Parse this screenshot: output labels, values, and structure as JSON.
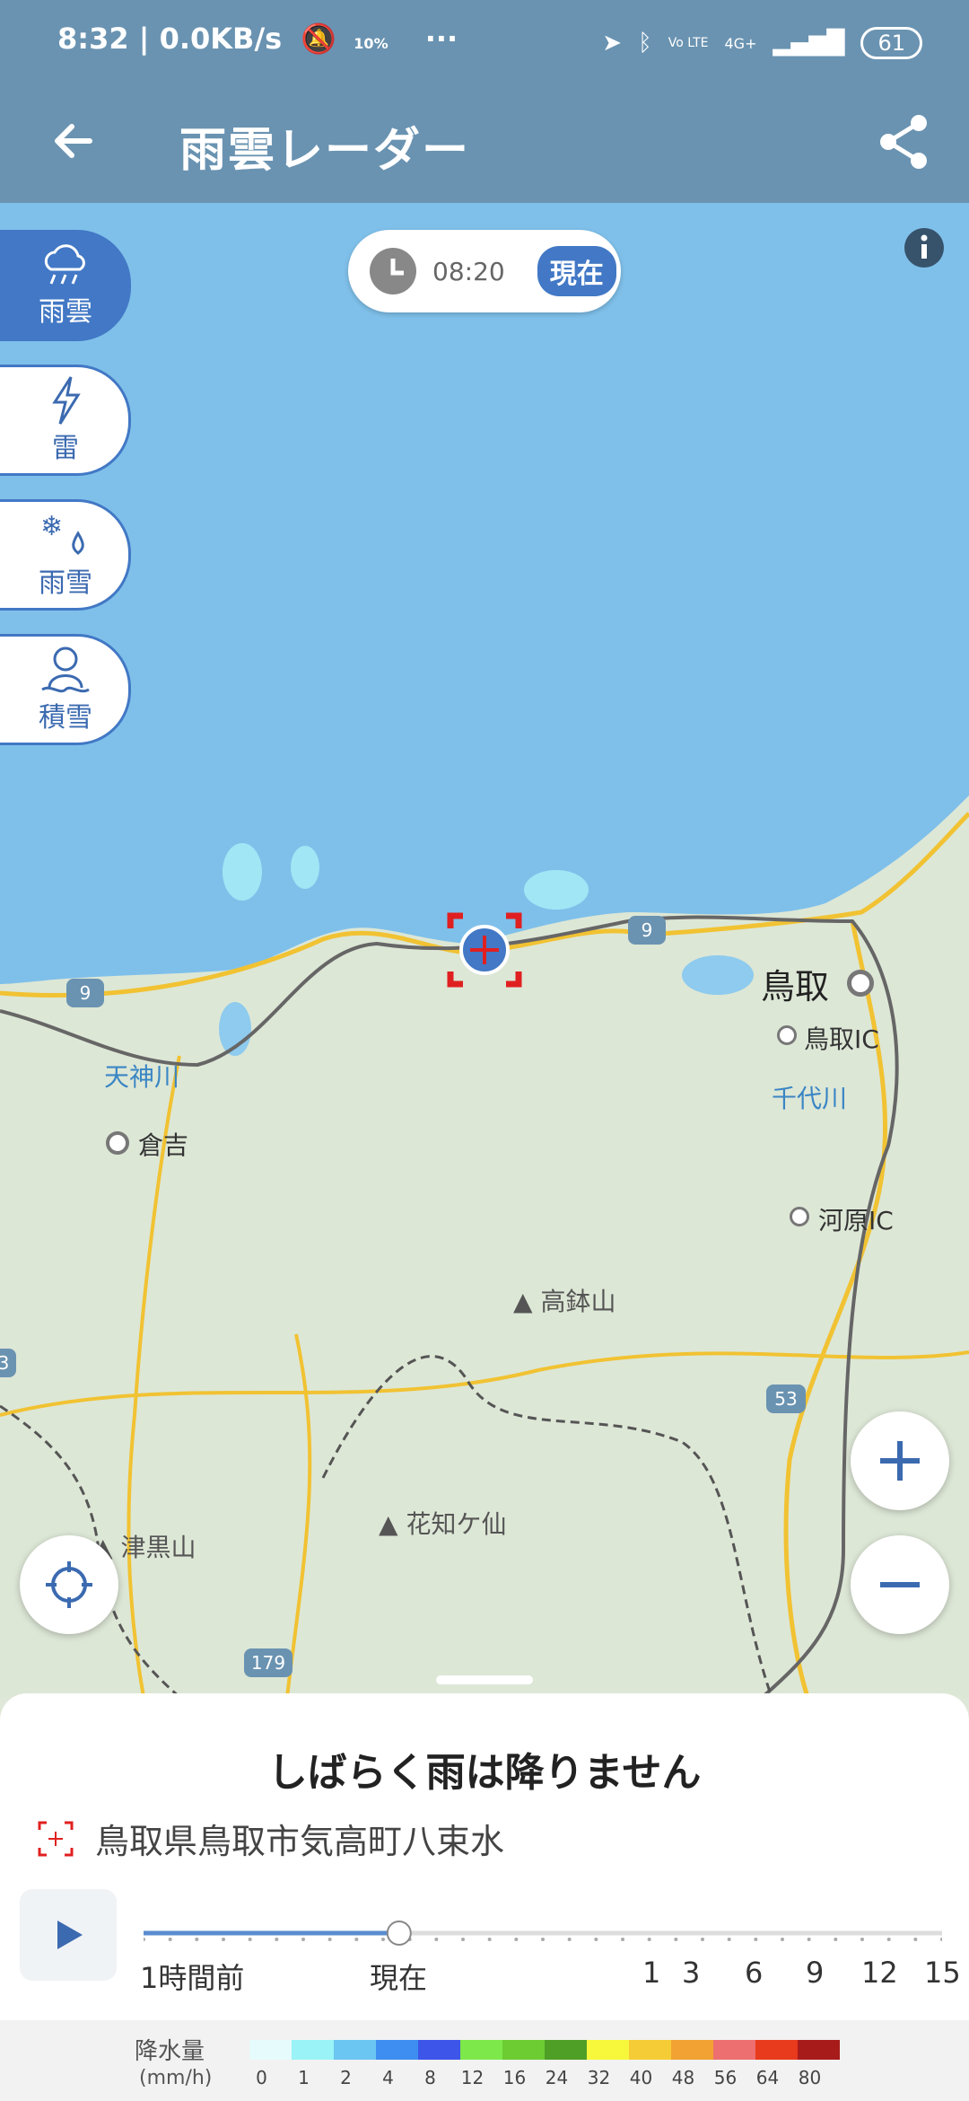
{
  "status_bar": {
    "time_speed": "8:32 | 0.0KB/s",
    "weather_pct": "10%",
    "more": "···",
    "net": "4G+",
    "volte": "Vo LTE",
    "battery": "61"
  },
  "app_bar": {
    "title": "雨雲レーダー"
  },
  "map": {
    "time": "08:20",
    "now_badge": "現在",
    "layers": [
      {
        "label": "雨雲",
        "icon": "rain-cloud-icon",
        "active": true
      },
      {
        "label": "雷",
        "icon": "lightning-icon",
        "active": false
      },
      {
        "label": "雨雪",
        "icon": "snow-rain-icon",
        "active": false
      },
      {
        "label": "積雪",
        "icon": "snowman-icon",
        "active": false
      }
    ],
    "places": {
      "tottori": "鳥取",
      "tottori_ic": "鳥取IC",
      "chiyogawa": "千代川",
      "kawahara_ic": "河原IC",
      "tenjingawa": "天神川",
      "kurayoshi": "倉吉",
      "takahachi": "高鉢山",
      "hanachigasen": "花知ケ仙",
      "tsuguro": "津黒山",
      "route9a": "9",
      "route9b": "9",
      "route53": "53",
      "route179": "179",
      "route3": "3"
    }
  },
  "sheet": {
    "headline": "しばらく雨は降りません",
    "address": "鳥取県鳥取市気高町八束水",
    "slider": {
      "past_label": "1時間前",
      "now_label": "現在",
      "ticks": [
        "1",
        "3",
        "6",
        "9",
        "12",
        "15"
      ],
      "position_fraction": 0.32
    }
  },
  "legend": {
    "title": "降水量",
    "unit": "(mm/h)",
    "values": [
      "0",
      "1",
      "2",
      "4",
      "8",
      "12",
      "16",
      "24",
      "32",
      "40",
      "48",
      "56",
      "64",
      "80"
    ],
    "colors": [
      "#e6fbfb",
      "#9af3f6",
      "#6cc6f2",
      "#3d8ef0",
      "#3d55e8",
      "#7de84a",
      "#6ccc32",
      "#4f9e26",
      "#f7f73b",
      "#f5cc36",
      "#f2a233",
      "#ee6f6f",
      "#e83a1d",
      "#a81b1b"
    ]
  }
}
